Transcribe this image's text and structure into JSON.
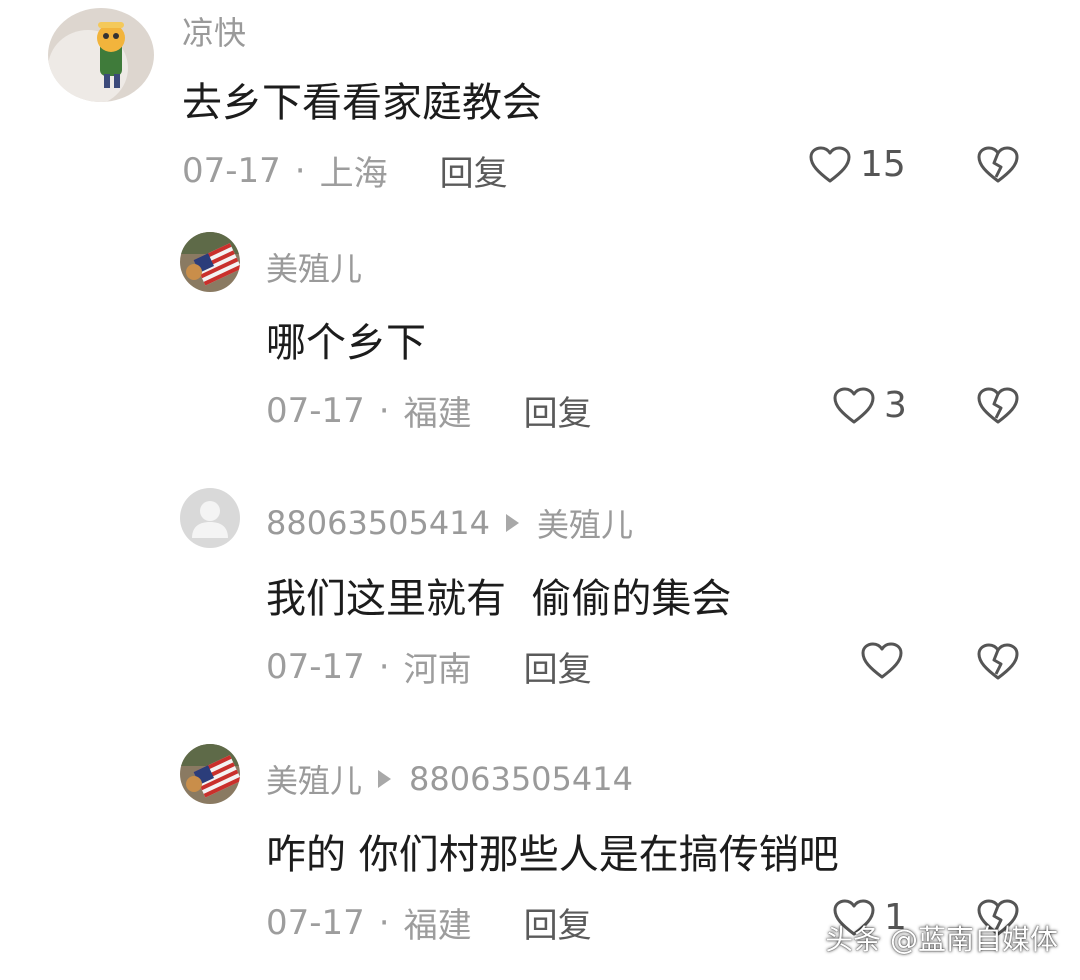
{
  "comments": [
    {
      "username": "凉快",
      "content": "去乡下看看家庭教会",
      "date": "07-17",
      "location": "上海",
      "reply_label": "回复",
      "likes": "15",
      "avatar_icon": "cartoon-figure-avatar"
    },
    {
      "username": "美殖儿",
      "content": "哪个乡下",
      "date": "07-17",
      "location": "福建",
      "reply_label": "回复",
      "likes": "3",
      "avatar_icon": "flag-avatar"
    },
    {
      "username": "88063505414",
      "reply_to": "美殖儿",
      "content": "我们这里就有  偷偷的集会",
      "date": "07-17",
      "location": "河南",
      "reply_label": "回复",
      "likes": "",
      "avatar_icon": "default-user-avatar"
    },
    {
      "username": "美殖儿",
      "reply_to": "88063505414",
      "content": "咋的 你们村那些人是在搞传销吧",
      "date": "07-17",
      "location": "福建",
      "reply_label": "回复",
      "likes": "1",
      "avatar_icon": "flag-avatar"
    }
  ],
  "separator": "·",
  "watermark": "头条 @蓝南自媒体",
  "colors": {
    "meta": "#9d9d9d",
    "username": "#9a9a9a",
    "content": "#1c1c1c"
  }
}
